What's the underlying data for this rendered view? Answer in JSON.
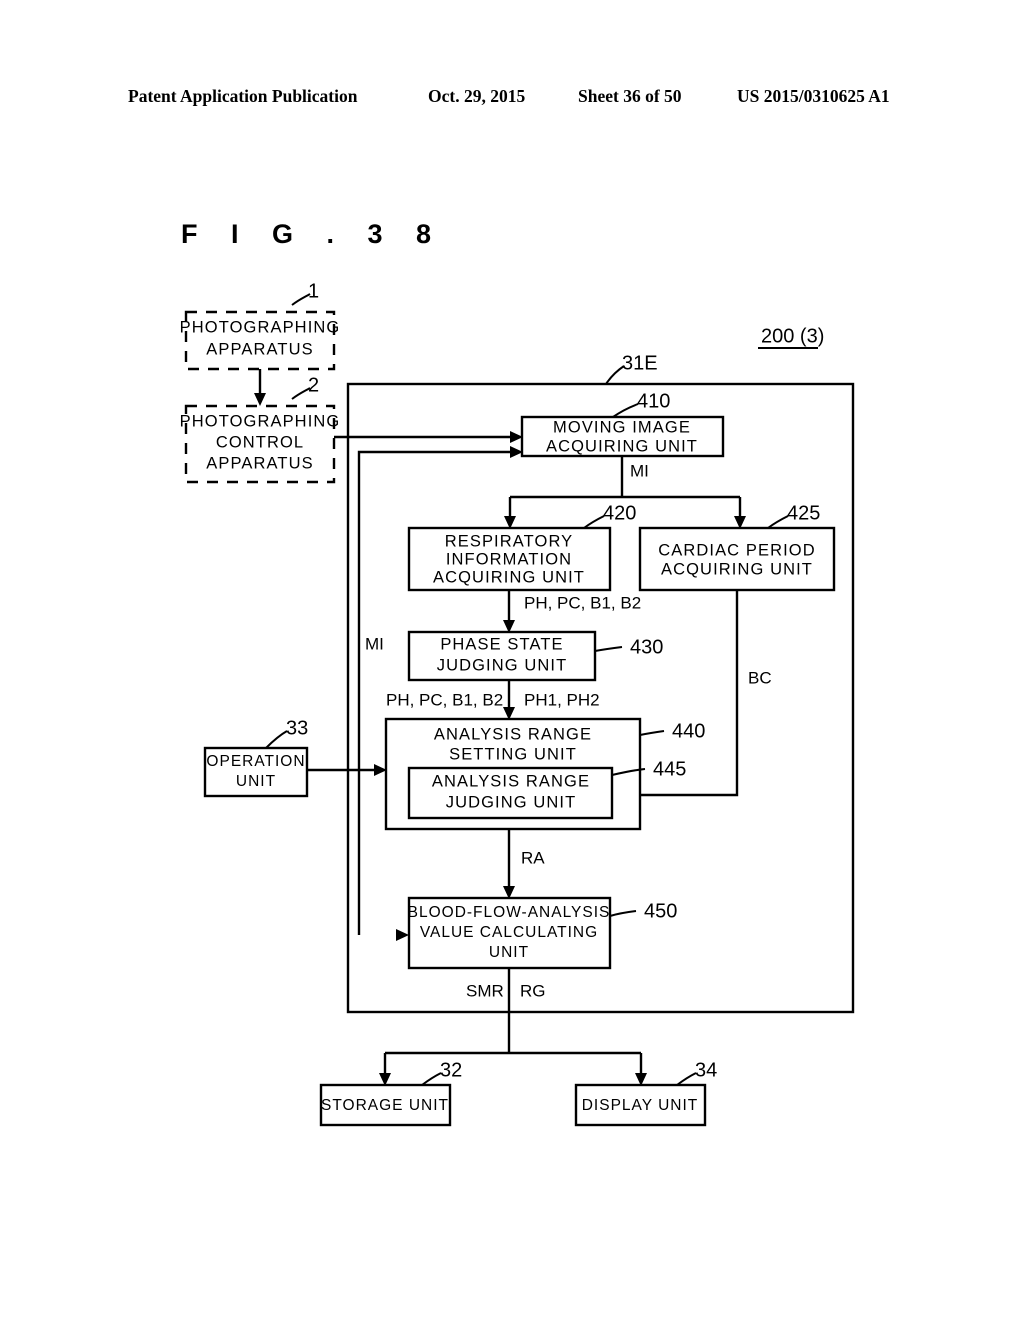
{
  "header": {
    "publication": "Patent Application Publication",
    "date": "Oct. 29, 2015",
    "sheet": "Sheet 36 of 50",
    "number": "US 2015/0310625 A1"
  },
  "figure": {
    "title": "F I G .  3 8"
  },
  "diagram": {
    "system_label": "200 (3)",
    "controller_ref": "31E",
    "external_blocks": [
      {
        "id": "photographing-apparatus",
        "label_lines": [
          "PHOTOGRAPHING",
          "APPARATUS"
        ],
        "ref": "1",
        "style": "dashed"
      },
      {
        "id": "photographing-control-apparatus",
        "label_lines": [
          "PHOTOGRAPHING",
          "CONTROL",
          "APPARATUS"
        ],
        "ref": "2",
        "style": "dashed"
      },
      {
        "id": "operation-unit",
        "label_lines": [
          "OPERATION",
          "UNIT"
        ],
        "ref": "33",
        "style": "solid"
      },
      {
        "id": "storage-unit",
        "label_lines": [
          "STORAGE UNIT"
        ],
        "ref": "32",
        "style": "solid"
      },
      {
        "id": "display-unit",
        "label_lines": [
          "DISPLAY UNIT"
        ],
        "ref": "34",
        "style": "solid"
      }
    ],
    "internal_blocks": [
      {
        "id": "moving-image-acquiring-unit",
        "label_lines": [
          "MOVING IMAGE",
          "ACQUIRING UNIT"
        ],
        "ref": "410"
      },
      {
        "id": "respiratory-information-acquiring-unit",
        "label_lines": [
          "RESPIRATORY",
          "INFORMATION",
          "ACQUIRING UNIT"
        ],
        "ref": "420"
      },
      {
        "id": "cardiac-period-acquiring-unit",
        "label_lines": [
          "CARDIAC PERIOD",
          "ACQUIRING UNIT"
        ],
        "ref": "425"
      },
      {
        "id": "phase-state-judging-unit",
        "label_lines": [
          "PHASE STATE",
          "JUDGING UNIT"
        ],
        "ref": "430"
      },
      {
        "id": "analysis-range-setting-unit",
        "label_lines": [
          "ANALYSIS RANGE",
          "SETTING UNIT"
        ],
        "ref": "440"
      },
      {
        "id": "analysis-range-judging-unit",
        "label_lines": [
          "ANALYSIS RANGE",
          "JUDGING UNIT"
        ],
        "ref": "445"
      },
      {
        "id": "blood-flow-analysis-value-calculating-unit",
        "label_lines": [
          "BLOOD-FLOW-ANALYSIS",
          "VALUE CALCULATING",
          "UNIT"
        ],
        "ref": "450"
      }
    ],
    "signal_labels": [
      {
        "id": "mi-top",
        "text": "MI"
      },
      {
        "id": "mi-left",
        "text": "MI"
      },
      {
        "id": "ph-pc-b1-b2-top",
        "text": "PH, PC, B1, B2"
      },
      {
        "id": "ph-pc-b1-b2-left",
        "text": "PH, PC, B1, B2"
      },
      {
        "id": "ph1-ph2",
        "text": "PH1, PH2"
      },
      {
        "id": "bc",
        "text": "BC"
      },
      {
        "id": "ra",
        "text": "RA"
      },
      {
        "id": "smr",
        "text": "SMR"
      },
      {
        "id": "rg",
        "text": "RG"
      }
    ]
  }
}
